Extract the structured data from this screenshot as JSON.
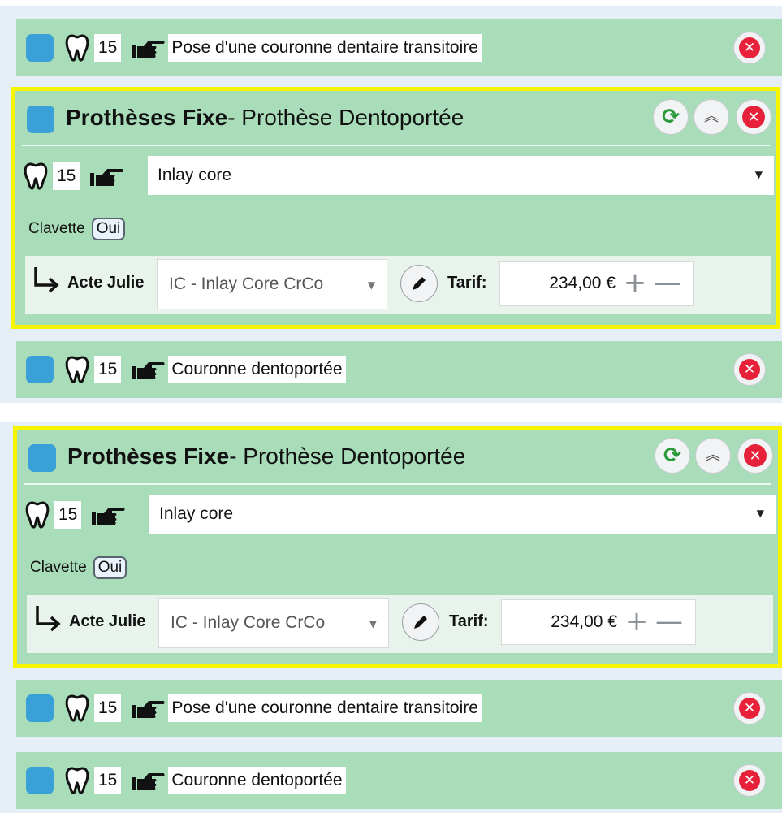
{
  "panel1": {
    "top_row": {
      "tooth_number": "15",
      "description": "Pose d'une couronne dentaire transitoire"
    },
    "card": {
      "title_bold": "Prothèses Fixe",
      "title_rest": "- Prothèse Dentoportée",
      "tooth_number": "15",
      "select_value": "Inlay core",
      "clavette_label": "Clavette",
      "clavette_value": "Oui",
      "acte_label": "Acte Julie",
      "acte_value": "IC - Inlay Core CrCo",
      "tarif_label": "Tarif:",
      "tarif_value": "234,00 €"
    },
    "bottom_row": {
      "tooth_number": "15",
      "description": "Couronne dentoportée"
    }
  },
  "panel2": {
    "card": {
      "title_bold": "Prothèses Fixe",
      "title_rest": "- Prothèse Dentoportée",
      "tooth_number": "15",
      "select_value": "Inlay core",
      "clavette_label": "Clavette",
      "clavette_value": "Oui",
      "acte_label": "Acte Julie",
      "acte_value": "IC - Inlay Core CrCo",
      "tarif_label": "Tarif:",
      "tarif_value": "234,00 €"
    },
    "row1": {
      "tooth_number": "15",
      "description": "Pose d'une couronne dentaire transitoire"
    },
    "row2": {
      "tooth_number": "15",
      "description": "Couronne dentoportée"
    }
  },
  "icons": {
    "checkbox_color": "#3aa0d8",
    "row_background": "#a9dcb9",
    "highlight_border": "#f5f500",
    "remove_color": "#e8213a",
    "refresh_color": "#2a9a3a",
    "close_glyph": "✕",
    "refresh_glyph": "⟳",
    "collapse_glyph": "︽",
    "caret_glyph": "▼",
    "plus_glyph": "+",
    "minus_glyph": "—"
  }
}
